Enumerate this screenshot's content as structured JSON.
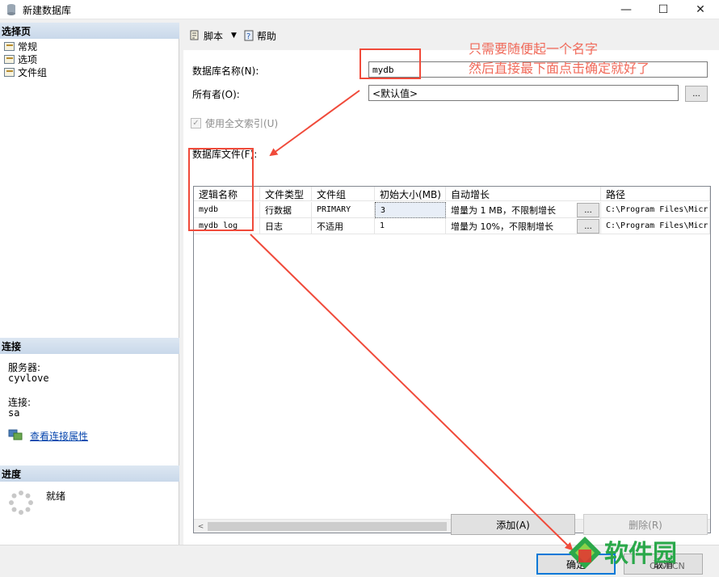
{
  "window": {
    "title": "新建数据库",
    "minimize": "—",
    "maximize": "☐",
    "close": "✕"
  },
  "sidebar": {
    "select_page": "选择页",
    "pages": [
      {
        "label": "常规",
        "icon": "page-icon"
      },
      {
        "label": "选项",
        "icon": "page-icon"
      },
      {
        "label": "文件组",
        "icon": "page-icon"
      }
    ],
    "connection_header": "连接",
    "server_label": "服务器:",
    "server_value": "cyvlove",
    "connection_label": "连接:",
    "connection_value": "sa",
    "view_connection_props": "查看连接属性",
    "progress_header": "进度",
    "progress_status": "就绪"
  },
  "toolbar": {
    "script_label": "脚本",
    "help_label": "帮助"
  },
  "form": {
    "db_name_label": "数据库名称(N):",
    "db_name_value": "mydb",
    "owner_label": "所有者(O):",
    "owner_value": "<默认值>",
    "owner_browse": "...",
    "fulltext_label": "使用全文索引(U)",
    "db_files_label": "数据库文件(F):"
  },
  "grid": {
    "columns": [
      "逻辑名称",
      "文件类型",
      "文件组",
      "初始大小(MB)",
      "自动增长",
      "路径"
    ],
    "rows": [
      {
        "logical_name": "mydb",
        "file_type": "行数据",
        "filegroup": "PRIMARY",
        "initial_size": "3",
        "autogrowth": "增量为 1 MB，不限制增长",
        "path": "C:\\Program Files\\Micr"
      },
      {
        "logical_name": "mydb_log",
        "file_type": "日志",
        "filegroup": "不适用",
        "initial_size": "1",
        "autogrowth": "增量为 10%，不限制增长",
        "path": "C:\\Program Files\\Micr"
      }
    ],
    "cell_button": "...",
    "scroll_left": "<",
    "scroll_right": ">"
  },
  "buttons": {
    "add": "添加(A)",
    "remove": "删除(R)",
    "ok": "确定",
    "cancel": "取消"
  },
  "annotation": {
    "line1": "只需要随便起一个名字",
    "line2": "然后直接最下面点击确定就好了",
    "color": "#f04a3a"
  },
  "watermark": {
    "brand": "软件园",
    "site": "CYVLCN"
  }
}
